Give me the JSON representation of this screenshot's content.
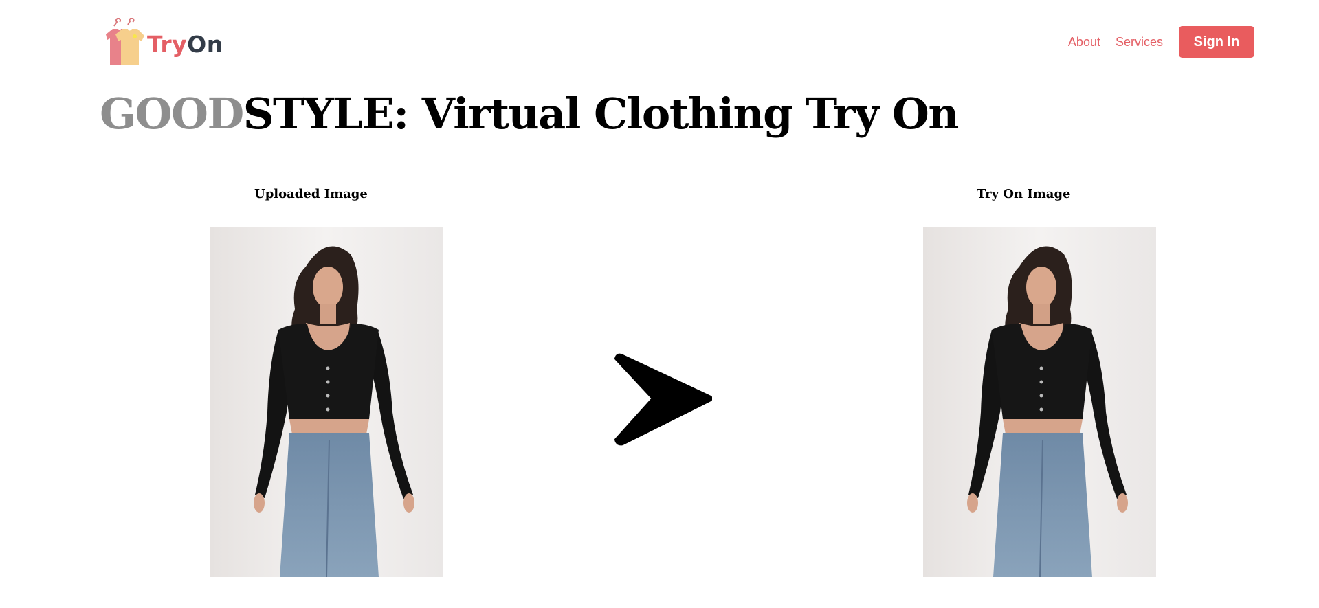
{
  "brand": {
    "name_part1": "Try",
    "name_part2": "On",
    "colors": {
      "accent": "#e45f65",
      "dark": "#333c48"
    }
  },
  "nav": {
    "items": [
      {
        "label": "About"
      },
      {
        "label": "Services"
      }
    ],
    "signin_label": "Sign In"
  },
  "headline": {
    "highlight": "GOOD",
    "rest": "STYLE: Virtual Clothing Try On"
  },
  "panels": {
    "uploaded": {
      "label": "Uploaded Image",
      "icon": "person-photo"
    },
    "tryon": {
      "label": "Try On Image",
      "icon": "person-photo"
    }
  },
  "arrow": {
    "icon": "arrow-right-icon"
  }
}
